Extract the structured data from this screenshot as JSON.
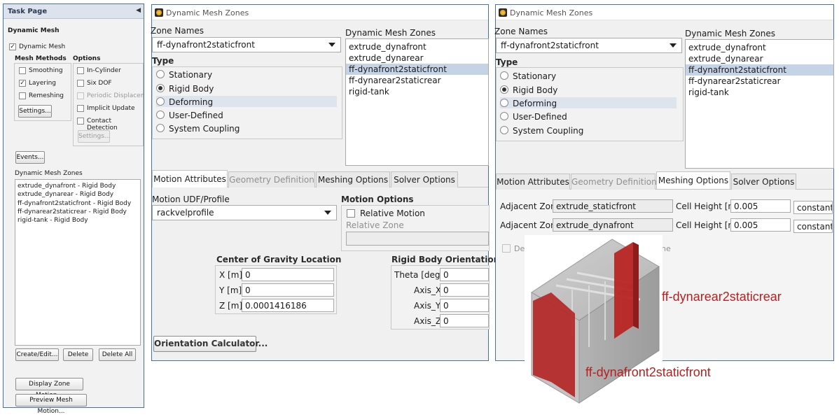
{
  "task_page": {
    "title": "Task Page",
    "section_title": "Dynamic Mesh",
    "dynamic_mesh_label": "Dynamic Mesh",
    "dynamic_mesh_checked": true,
    "mesh_methods": {
      "title": "Mesh Methods",
      "items": [
        {
          "label": "Smoothing",
          "checked": false
        },
        {
          "label": "Layering",
          "checked": true
        },
        {
          "label": "Remeshing",
          "checked": false
        }
      ],
      "settings_label": "Settings..."
    },
    "options": {
      "title": "Options",
      "items": [
        {
          "label": "In-Cylinder",
          "checked": false,
          "enabled": true
        },
        {
          "label": "Six DOF",
          "checked": false,
          "enabled": true
        },
        {
          "label": "Periodic Displaceme",
          "checked": false,
          "enabled": false
        },
        {
          "label": "Implicit Update",
          "checked": false,
          "enabled": true
        },
        {
          "label": "Contact Detection",
          "checked": false,
          "enabled": true
        }
      ],
      "settings_label": "Settings..."
    },
    "events_label": "Events...",
    "zones_title": "Dynamic Mesh Zones",
    "zones": [
      "extrude_dynafront - Rigid Body",
      "extrude_dynarear - Rigid Body",
      "ff-dynafront2staticfront - Rigid Body",
      "ff-dynarear2staticrear - Rigid Body",
      "rigid-tank - Rigid Body"
    ],
    "create_edit_label": "Create/Edit...",
    "delete_label": "Delete",
    "delete_all_label": "Delete All",
    "display_zone_motion_label": "Display Zone Motion...",
    "preview_mesh_motion_label": "Preview Mesh Motion..."
  },
  "dialog1": {
    "title": "Dynamic Mesh Zones",
    "zone_names_label": "Zone Names",
    "zone_name_value": "ff-dynafront2staticfront",
    "zones_list_title": "Dynamic Mesh Zones",
    "zones_list": [
      "extrude_dynafront",
      "extrude_dynarear",
      "ff-dynafront2staticfront",
      "ff-dynarear2staticrear",
      "rigid-tank"
    ],
    "type_label": "Type",
    "types": [
      "Stationary",
      "Rigid Body",
      "Deforming",
      "User-Defined",
      "System Coupling"
    ],
    "tabs": [
      "Motion Attributes",
      "Geometry Definition",
      "Meshing Options",
      "Solver Options"
    ],
    "motion_udf_label": "Motion UDF/Profile",
    "motion_udf_value": "rackvelprofile",
    "motion_options_title": "Motion Options",
    "relative_motion_label": "Relative Motion",
    "relative_zone_label": "Relative Zone",
    "cog_title": "Center of Gravity Location",
    "cog": [
      {
        "label": "X [m]",
        "value": "0"
      },
      {
        "label": "Y [m]",
        "value": "0"
      },
      {
        "label": "Z [m]",
        "value": "0.0001416186"
      }
    ],
    "orientation_title": "Rigid Body Orientation",
    "orientation": [
      {
        "label": "Theta [deg]",
        "value": "0"
      },
      {
        "label": "Axis_X",
        "value": "0"
      },
      {
        "label": "Axis_Y",
        "value": "0"
      },
      {
        "label": "Axis_Z",
        "value": "0"
      }
    ],
    "orientation_calc_label": "Orientation Calculator..."
  },
  "dialog2": {
    "title": "Dynamic Mesh Zones",
    "zone_names_label": "Zone Names",
    "zone_name_value": "ff-dynafront2staticfront",
    "zones_list_title": "Dynamic Mesh Zones",
    "zones_list": [
      "extrude_dynafront",
      "extrude_dynarear",
      "ff-dynafront2staticfront",
      "ff-dynarear2staticrear",
      "rigid-tank"
    ],
    "type_label": "Type",
    "types": [
      "Stationary",
      "Rigid Body",
      "Deforming",
      "User-Defined",
      "System Coupling"
    ],
    "tabs": [
      "Motion Attributes",
      "Geometry Definition",
      "Meshing Options",
      "Solver Options"
    ],
    "adjacent_rows": [
      {
        "label": "Adjacent Zone",
        "zone": "extrude_staticfront",
        "height_label": "Cell Height [m]",
        "height": "0.005",
        "method": "constant"
      },
      {
        "label": "Adjacent Zone",
        "zone": "extrude_dynafront",
        "height_label": "Cell Height [m]",
        "height": "0.005",
        "method": "constant"
      }
    ],
    "hidden_text_left": "Def",
    "hidden_text_right": "ne"
  },
  "overlay": {
    "label_rear": "ff-dynarear2staticrear",
    "label_front": "ff-dynafront2staticfront"
  },
  "colors": {
    "accent_border": "#4a6fa5",
    "selection": "#c5d3e6",
    "highlight_red": "#b82020"
  }
}
